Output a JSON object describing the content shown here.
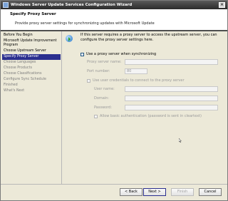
{
  "window": {
    "title": "Windows Server Update Services Configuration Wizard",
    "close_glyph": "×"
  },
  "header": {
    "title": "Specify Proxy Server",
    "subtitle": "Provide proxy server settings for synchronizing updates with Microsoft Update"
  },
  "sidebar": {
    "items": [
      {
        "label": "Before You Begin",
        "state": "normal"
      },
      {
        "label": "Microsoft Update Improvement Program",
        "state": "normal"
      },
      {
        "label": "Choose Upstream Server",
        "state": "normal"
      },
      {
        "label": "Specify Proxy Server",
        "state": "selected"
      },
      {
        "label": "Choose Languages",
        "state": "disabled"
      },
      {
        "label": "Choose Products",
        "state": "disabled"
      },
      {
        "label": "Choose Classifications",
        "state": "disabled"
      },
      {
        "label": "Configure Sync Schedule",
        "state": "disabled"
      },
      {
        "label": "Finished",
        "state": "disabled"
      },
      {
        "label": "What's Next",
        "state": "disabled"
      }
    ]
  },
  "main": {
    "intro": "If this server requires a proxy server to access the upstream server, you can configure the proxy server settings here.",
    "use_proxy_label": "Use a proxy server when synchronizing",
    "proxy_name_label": "Proxy server name:",
    "proxy_name_value": "",
    "port_label": "Port number:",
    "port_value": "80",
    "use_credentials_label": "Use user credentials to connect to the proxy server",
    "user_name_label": "User name:",
    "domain_label": "Domain:",
    "password_label": "Password:",
    "basic_auth_label": "Allow basic authentication (password is sent in cleartext)"
  },
  "footer": {
    "back_label": "< Back",
    "next_label": "Next >",
    "finish_label": "Finish",
    "cancel_label": "Cancel"
  }
}
